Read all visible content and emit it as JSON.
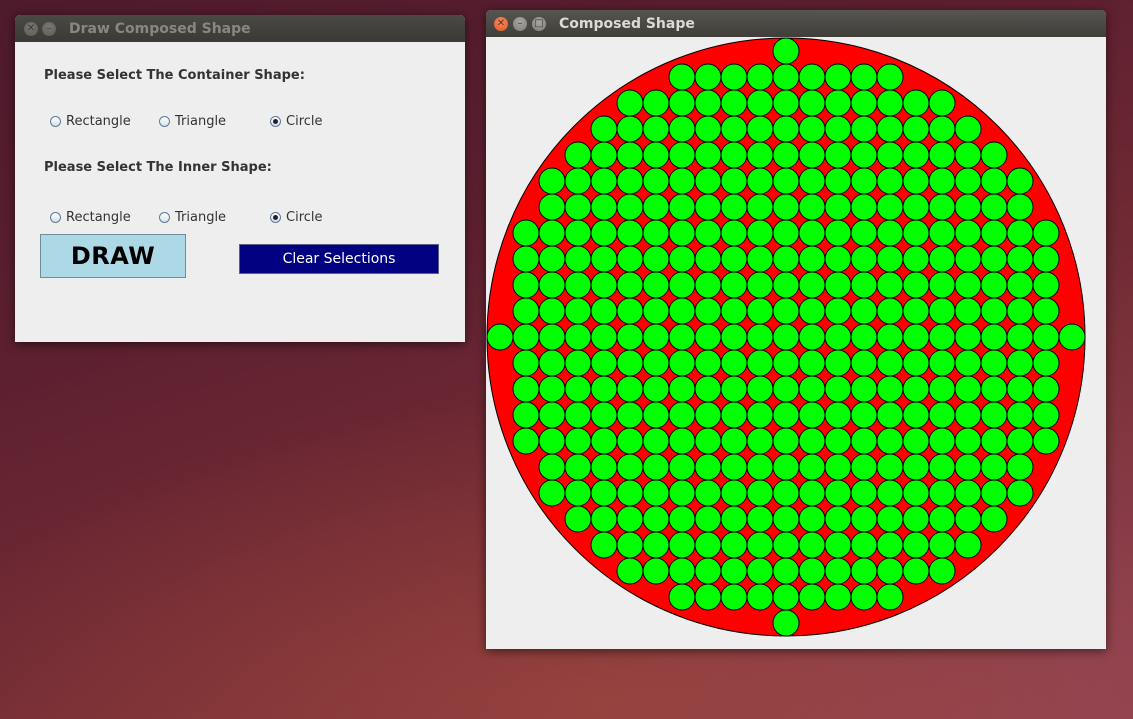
{
  "control_window": {
    "title": "Draw Composed Shape",
    "container_label": "Please Select The Container Shape:",
    "container_options": [
      {
        "label": "Rectangle",
        "checked": false
      },
      {
        "label": "Triangle",
        "checked": false
      },
      {
        "label": "Circle",
        "checked": true
      }
    ],
    "inner_label": "Please Select The Inner Shape:",
    "inner_options": [
      {
        "label": "Rectangle",
        "checked": false
      },
      {
        "label": "Triangle",
        "checked": false
      },
      {
        "label": "Circle",
        "checked": true
      }
    ],
    "draw_label": "DRAW",
    "clear_label": "Clear Selections"
  },
  "shape_window": {
    "title": "Composed Shape",
    "container_shape": "circle",
    "inner_shape": "circle",
    "container_color": "#ff0000",
    "inner_color": "#00ff00",
    "background_color": "#eeeeee"
  },
  "colors": {
    "draw_button_bg": "#add8e6",
    "clear_button_bg": "#000080",
    "close_button": "#e0581f"
  },
  "icons": [
    "close-icon",
    "minimize-icon",
    "maximize-icon"
  ]
}
